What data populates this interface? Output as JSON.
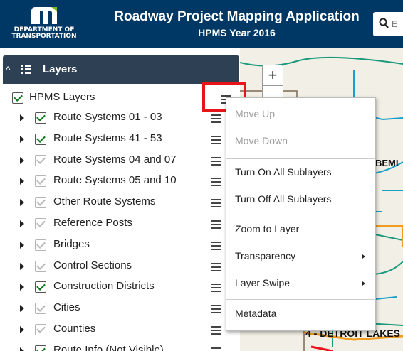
{
  "header": {
    "logo_text_line1": "DEPARTMENT OF",
    "logo_text_line2": "TRANSPORTATION",
    "title": "Roadway Project Mapping Application",
    "subtitle": "HPMS Year 2016",
    "search_placeholder": "E"
  },
  "panel": {
    "title": "Layers",
    "group": {
      "label": "HPMS Layers",
      "checked": true
    },
    "layers": [
      {
        "label": "Route Systems 01 - 03",
        "checked": true
      },
      {
        "label": "Route Systems 41 - 53",
        "checked": true
      },
      {
        "label": "Route Systems 04 and 07",
        "checked": false
      },
      {
        "label": "Route Systems 05 and 10",
        "checked": false
      },
      {
        "label": "Other Route Systems",
        "checked": false
      },
      {
        "label": "Reference Posts",
        "checked": false
      },
      {
        "label": "Bridges",
        "checked": false
      },
      {
        "label": "Control Sections",
        "checked": false
      },
      {
        "label": "Construction Districts",
        "checked": true
      },
      {
        "label": "Cities",
        "checked": false
      },
      {
        "label": "Counties",
        "checked": false
      },
      {
        "label": "Route Info (Not Visible)",
        "checked": true
      }
    ]
  },
  "context_menu": {
    "items": [
      {
        "label": "Move Up",
        "disabled": true
      },
      {
        "label": "Move Down",
        "disabled": true
      },
      {
        "label": "Turn On All Sublayers",
        "disabled": false
      },
      {
        "label": "Turn Off All Sublayers",
        "disabled": false
      },
      {
        "label": "Zoom to Layer",
        "disabled": false
      },
      {
        "label": "Transparency",
        "disabled": false,
        "submenu": true
      },
      {
        "label": "Layer Swipe",
        "disabled": false,
        "submenu": true
      },
      {
        "label": "Metadata",
        "disabled": false
      }
    ]
  },
  "map": {
    "zoom_in_label": "+",
    "labels": [
      "BEMI",
      "4 - DETROIT LAKES"
    ]
  },
  "colors": {
    "header_bg": "#003865",
    "panel_header_bg": "#2e4053",
    "highlight": "#e8141b",
    "check_green": "#0a7a1a"
  }
}
